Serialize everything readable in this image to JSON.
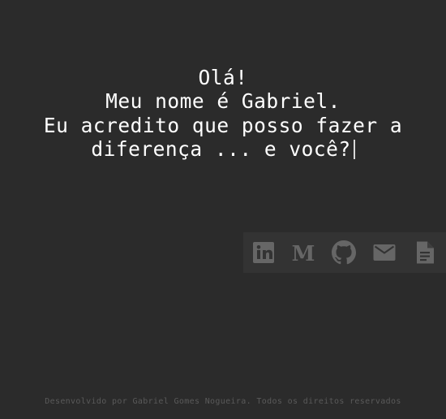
{
  "intro": {
    "line1": "Olá!",
    "line2": "Meu nome é Gabriel.",
    "line3": "Eu acredito que posso fazer a",
    "line4": "diferença ... e você?"
  },
  "social": [
    {
      "icon": "linkedin-icon"
    },
    {
      "icon": "medium-icon",
      "glyph": "M"
    },
    {
      "icon": "github-icon"
    },
    {
      "icon": "mail-icon"
    },
    {
      "icon": "document-icon"
    }
  ],
  "footer": {
    "text": "Desenvolvido por Gabriel Gomes Nogueira. Todos os direitos reservados"
  },
  "colors": {
    "background": "#2b2b2b",
    "social_bar": "#333333",
    "icon": "#666666",
    "text": "#ffffff",
    "footer_text": "#5a5a5a"
  }
}
